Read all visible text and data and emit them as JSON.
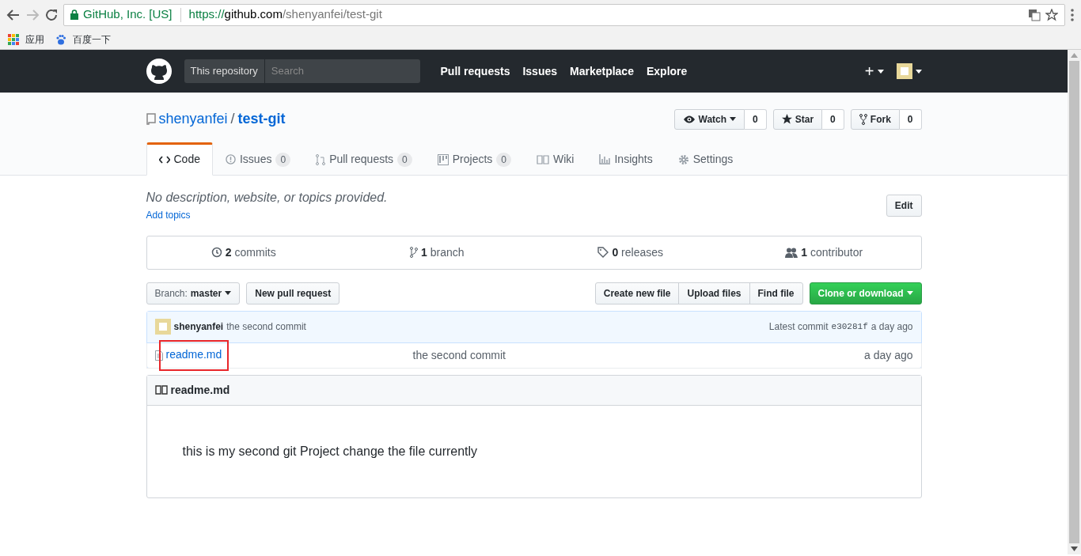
{
  "browser": {
    "secure_label": "GitHub, Inc. [US]",
    "url": {
      "scheme": "https://",
      "host": "github.com",
      "path": "/shenyanfei/test-git"
    },
    "bookmarks": [
      {
        "label": "应用",
        "kind": "apps"
      },
      {
        "label": "百度一下",
        "kind": "paw"
      }
    ]
  },
  "header": {
    "scope": "This repository",
    "search": {
      "placeholder": "Search"
    },
    "nav": [
      "Pull requests",
      "Issues",
      "Marketplace",
      "Explore"
    ],
    "new_menu": "+"
  },
  "repo": {
    "owner": "shenyanfei",
    "separator": "/",
    "name": "test-git",
    "actions": [
      {
        "kind": "watch",
        "label": "Watch",
        "count": "0"
      },
      {
        "kind": "star",
        "label": "Star",
        "count": "0"
      },
      {
        "kind": "fork",
        "label": "Fork",
        "count": "0"
      }
    ],
    "tabs": [
      {
        "kind": "code",
        "label": "Code",
        "selected": true
      },
      {
        "kind": "issues",
        "label": "Issues",
        "count": "0",
        "selected": false
      },
      {
        "kind": "pulls",
        "label": "Pull requests",
        "count": "0",
        "selected": false
      },
      {
        "kind": "projects",
        "label": "Projects",
        "count": "0",
        "selected": false
      },
      {
        "kind": "wiki",
        "label": "Wiki",
        "selected": false
      },
      {
        "kind": "insights",
        "label": "Insights",
        "selected": false
      },
      {
        "kind": "settings",
        "label": "Settings",
        "selected": false
      }
    ],
    "description": "No description, website, or topics provided.",
    "add_topics": "Add topics",
    "edit": "Edit",
    "stats": [
      {
        "kind": "commits",
        "count": "2",
        "label": "commits"
      },
      {
        "kind": "branch",
        "count": "1",
        "label": "branch"
      },
      {
        "kind": "releases",
        "count": "0",
        "label": "releases"
      },
      {
        "kind": "contributors",
        "count": "1",
        "label": "contributor"
      }
    ],
    "branch": {
      "prefix": "Branch:",
      "name": "master"
    },
    "new_pull_request": "New pull request",
    "file_buttons": [
      "Create new file",
      "Upload files",
      "Find file"
    ],
    "clone": "Clone or download",
    "commit": {
      "author": "shenyanfei",
      "message": "the second commit",
      "prefix": "Latest commit",
      "sha": "e30281f",
      "time": "a day ago"
    },
    "files": [
      {
        "name": "readme.md",
        "message": "the second commit",
        "time": "a day ago",
        "highlighted": true
      }
    ],
    "readme": {
      "title": "readme.md",
      "body": "this is my second git Project change the file currently"
    }
  }
}
